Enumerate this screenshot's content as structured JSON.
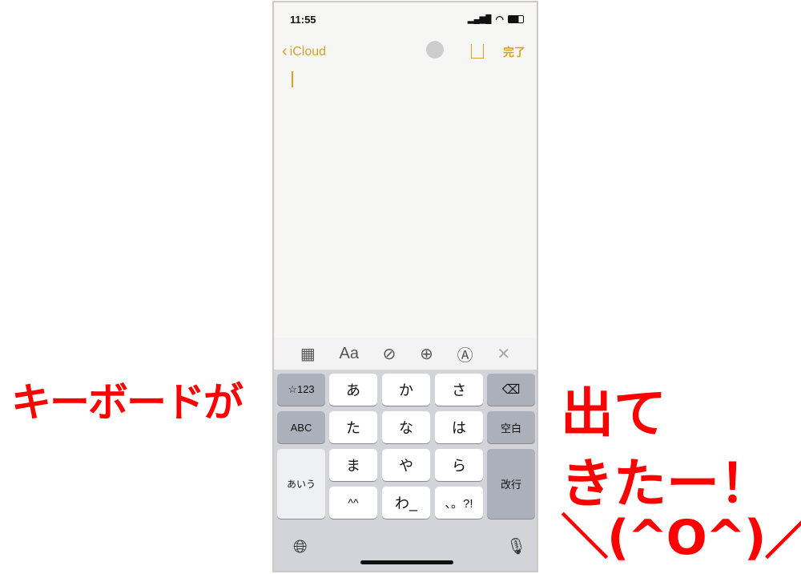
{
  "status": {
    "time": "11:55"
  },
  "nav": {
    "back_label": "iCloud",
    "done_label": "完了"
  },
  "toolbar": {
    "format_label": "Aa",
    "icons": [
      "table-icon",
      "format-icon",
      "checklist-icon",
      "add-icon",
      "markup-icon",
      "close-icon"
    ]
  },
  "keyboard": {
    "rows": [
      [
        "☆123",
        "あ",
        "か",
        "さ",
        "⌫"
      ],
      [
        "ABC",
        "た",
        "な",
        "は",
        "空白"
      ],
      [
        "あいう",
        "ま",
        "や",
        "ら",
        "改行"
      ],
      [
        "^^",
        "わ_",
        "、。?!"
      ]
    ]
  },
  "annotation": {
    "left": "キーボードが",
    "right_line1": "出て",
    "right_line2": "きたー！",
    "right_line3": "＼(^O^)／",
    "color": "#ff0000"
  },
  "accent": "#d4a326"
}
